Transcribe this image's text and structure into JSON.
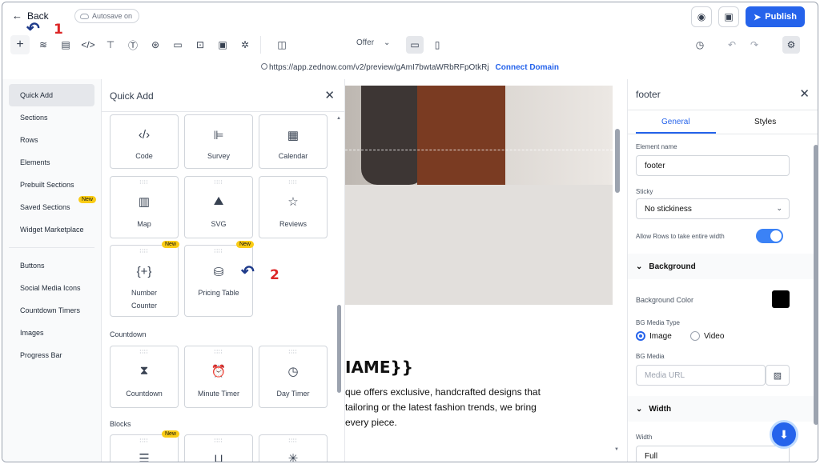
{
  "topbar": {
    "back_label": "Back",
    "autosave_label": "Autosave on",
    "publish_label": "Publish"
  },
  "toolbar": {
    "offer_label": "Offer",
    "offer_chevron": "⌄"
  },
  "urlbar": {
    "url": "https://app.zednow.com/v2/preview/gAmI7bwtaWRbRFpOtkRj",
    "connect_label": "Connect Domain"
  },
  "leftnav": {
    "items": [
      "Quick Add",
      "Sections",
      "Rows",
      "Elements",
      "Prebuilt Sections",
      "Saved Sections",
      "Widget Marketplace"
    ],
    "items2": [
      "Buttons",
      "Social Media Icons",
      "Countdown Timers",
      "Images",
      "Progress Bar"
    ],
    "new_badge": "New"
  },
  "quick": {
    "title": "Quick Add",
    "tiles_row1": [
      "Code",
      "Survey",
      "Calendar"
    ],
    "tiles_row2": [
      "Map",
      "SVG",
      "Reviews"
    ],
    "tile_number_line1": "Number",
    "tile_number_line2": "Counter",
    "tile_pricing": "Pricing Table",
    "new_badge": "New",
    "countdown_section": "Countdown",
    "tiles_countdown": [
      "Countdown",
      "Minute Timer",
      "Day Timer"
    ],
    "blocks_section": "Blocks"
  },
  "canvas": {
    "heading": "IAME}}",
    "text_line1": "que offers exclusive, handcrafted designs that",
    "text_line2": " tailoring or the latest fashion trends, we bring",
    "text_line3": "every piece."
  },
  "rpanel": {
    "title": "footer",
    "tab_general": "General",
    "tab_styles": "Styles",
    "element_name_label": "Element name",
    "element_name_value": "footer",
    "sticky_label": "Sticky",
    "sticky_value": "No stickiness",
    "rows_label": "Allow Rows to take entire width",
    "background_head": "Background",
    "bg_color_label": "Background Color",
    "bg_media_type_label": "BG Media Type",
    "radio_image": "Image",
    "radio_video": "Video",
    "bg_media_label": "BG Media",
    "media_placeholder": "Media URL",
    "width_head": "Width",
    "width_label": "Width",
    "width_value": "Full"
  },
  "annotations": {
    "step1": "1",
    "step2": "2"
  },
  "colors": {
    "accent": "#2563eb",
    "badge": "#facc15",
    "annotation_number": "#dc2626"
  }
}
